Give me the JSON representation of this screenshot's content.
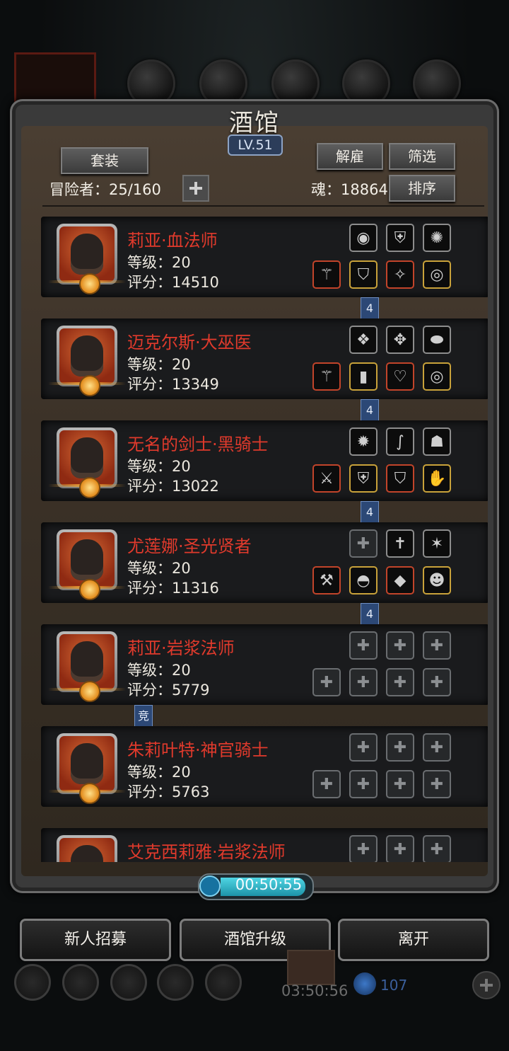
{
  "panel": {
    "title": "酒馆",
    "level": "LV.51"
  },
  "buttons": {
    "set": "套装",
    "dismiss": "解雇",
    "filter": "筛选",
    "sort": "排序"
  },
  "stats": {
    "adventurers": "冒险者：25/160",
    "soul": "魂：18864"
  },
  "heroes": [
    {
      "name": "莉亚·血法师",
      "level": "等级：20",
      "score": "评分：14510",
      "slots_top": [
        "orb-icon",
        "armor-icon",
        "amulet-icon"
      ],
      "slots_bottom": [
        "staff-icon",
        "shield-icon",
        "boots-icon",
        "ring-icon"
      ],
      "badge": "4"
    },
    {
      "name": "迈克尔斯·大巫医",
      "level": "等级：20",
      "score": "评分：13349",
      "slots_top": [
        "crystal-icon",
        "robe-icon",
        "gem-icon"
      ],
      "slots_bottom": [
        "staff-icon",
        "pants-icon",
        "necklace-icon",
        "ring-icon"
      ],
      "badge": "4"
    },
    {
      "name": "无名的剑士·黑骑士",
      "level": "等级：20",
      "score": "评分：13022",
      "slots_top": [
        "fire-icon",
        "whip-icon",
        "lantern-icon"
      ],
      "slots_bottom": [
        "sword-icon",
        "armor-icon",
        "shield-icon",
        "gauntlet-icon"
      ],
      "badge": "4"
    },
    {
      "name": "尤莲娜·圣光贤者",
      "level": "等级：20",
      "score": "评分：11316",
      "slots_top": [
        "empty-slot",
        "cross-icon",
        "crest-icon"
      ],
      "slots_bottom": [
        "hammer-icon",
        "helmet-icon",
        "emerald-icon",
        "mask-icon"
      ],
      "badge": "4"
    },
    {
      "name": "莉亚·岩浆法师",
      "level": "等级：20",
      "score": "评分：5779",
      "slots_top": [
        "empty-slot",
        "empty-slot",
        "empty-slot"
      ],
      "slots_bottom": [
        "empty-slot",
        "empty-slot",
        "empty-slot",
        "empty-slot"
      ],
      "badge": "竞"
    },
    {
      "name": "朱莉叶特·神官骑士",
      "level": "等级：20",
      "score": "评分：5763",
      "slots_top": [
        "empty-slot",
        "empty-slot",
        "empty-slot"
      ],
      "slots_bottom": [
        "empty-slot",
        "empty-slot",
        "empty-slot",
        "empty-slot"
      ],
      "badge": ""
    },
    {
      "name": "艾克西莉雅·岩浆法师",
      "level": "",
      "score": "",
      "slots_top": [
        "empty-slot",
        "empty-slot",
        "empty-slot"
      ],
      "slots_bottom": [],
      "badge": ""
    }
  ],
  "timer": "00:50:55",
  "actions": {
    "recruit": "新人招募",
    "upgrade": "酒馆升级",
    "leave": "离开"
  },
  "dock": {
    "time": "03:50:56",
    "gems": "107"
  },
  "colors": {
    "hero_name": "#e03a2c",
    "badge": "#2c4876",
    "timer_fill": "#4fd5e3"
  }
}
